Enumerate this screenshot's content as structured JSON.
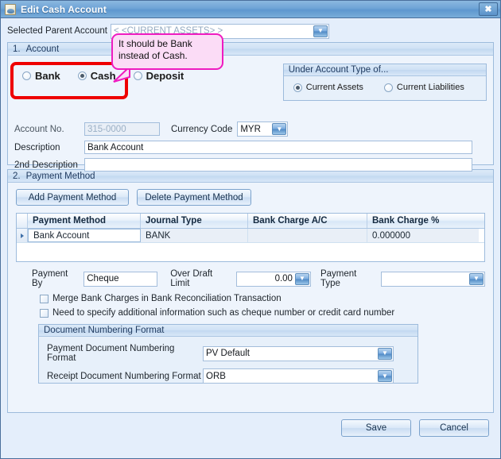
{
  "window": {
    "title": "Edit Cash Account",
    "icon": "document-icon",
    "close_label": "✖"
  },
  "parent_account": {
    "label": "Selected Parent Account",
    "value": "< <CURRENT ASSETS> >"
  },
  "section_account": {
    "number": "1.",
    "title": "Account",
    "account_types": [
      {
        "label": "Bank",
        "selected": false
      },
      {
        "label": "Cash",
        "selected": true
      },
      {
        "label": "Deposit",
        "selected": false
      }
    ],
    "under_group": {
      "title": "Under Account Type of...",
      "options": [
        {
          "label": "Current Assets",
          "selected": true
        },
        {
          "label": "Current Liabilities",
          "selected": false
        }
      ]
    },
    "fields": {
      "account_no_label": "Account No.",
      "account_no_value": "315-0000",
      "currency_label": "Currency Code",
      "currency_value": "MYR",
      "description_label": "Description",
      "description_value": "Bank Account",
      "description2_label": "2nd Description",
      "description2_value": ""
    }
  },
  "section_payment": {
    "number": "2.",
    "title": "Payment Method",
    "add_button": "Add Payment Method",
    "delete_button": "Delete Payment Method",
    "grid": {
      "columns": [
        "Payment Method",
        "Journal Type",
        "Bank Charge A/C",
        "Bank Charge %"
      ],
      "rows": [
        {
          "payment_method": "Bank Account",
          "journal_type": "BANK",
          "bank_charge_ac": "",
          "bank_charge_pct": "0.000000"
        }
      ]
    },
    "payment_by_label": "Payment By",
    "payment_by_value": "Cheque",
    "over_draft_label": "Over Draft Limit",
    "over_draft_value": "0.00",
    "payment_type_label": "Payment Type",
    "payment_type_value": "",
    "checkbox_merge": {
      "label": "Merge Bank Charges in Bank Reconciliation Transaction",
      "checked": false
    },
    "checkbox_additional": {
      "label": "Need to specify additional information such as cheque number or credit card number",
      "checked": false
    },
    "doc_numbering": {
      "title": "Document Numbering Format",
      "payment_label": "Payment Document Numbering Format",
      "payment_value": "PV Default",
      "receipt_label": "Receipt Document Numbering Format",
      "receipt_value": "ORB"
    }
  },
  "footer": {
    "save_label": "Save",
    "cancel_label": "Cancel"
  },
  "annotation": {
    "callout_line1": "It should be Bank",
    "callout_line2": "instead of Cash.",
    "callout_bg": "#fbdcf6",
    "callout_border": "#ef1bc0",
    "highlight_border": "#ee0000"
  }
}
